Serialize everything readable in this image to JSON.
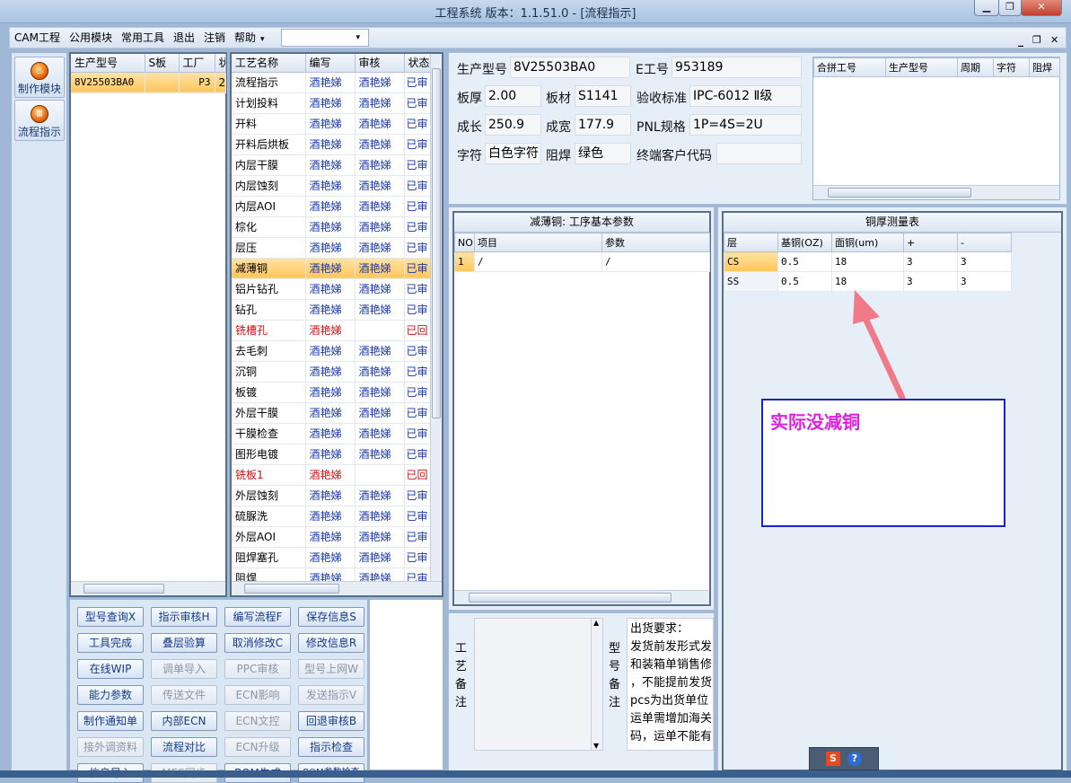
{
  "window": {
    "title": "工程系统  版本：1.1.51.0 - [流程指示]",
    "min": "▁",
    "max": "❐",
    "close": "✕"
  },
  "menu": {
    "items": [
      "CAM工程",
      "公用模块",
      "常用工具",
      "退出",
      "注销",
      "帮助"
    ],
    "dropdown_arrow": "▾",
    "ctl_min": "_",
    "ctl_restore": "❐",
    "ctl_close": "✕"
  },
  "nav": [
    {
      "label": "制作模块",
      "icon": "fire-icon"
    },
    {
      "label": "流程指示",
      "icon": "flow-icon"
    }
  ],
  "model_table": {
    "headers": [
      "生产型号",
      "S板",
      "工厂",
      "状"
    ],
    "rows": [
      [
        "8V25503BA0",
        "",
        "P3",
        "2"
      ]
    ]
  },
  "process_table": {
    "headers": [
      "工艺名称",
      "编写",
      "审核",
      "状态"
    ],
    "rows": [
      {
        "name": "流程指示",
        "writer": "酒艳娣",
        "reviewer": "酒艳娣",
        "status": "已审",
        "red": false,
        "sel": false
      },
      {
        "name": "计划投料",
        "writer": "酒艳娣",
        "reviewer": "酒艳娣",
        "status": "已审",
        "red": false,
        "sel": false
      },
      {
        "name": "开料",
        "writer": "酒艳娣",
        "reviewer": "酒艳娣",
        "status": "已审",
        "red": false,
        "sel": false
      },
      {
        "name": "开料后烘板",
        "writer": "酒艳娣",
        "reviewer": "酒艳娣",
        "status": "已审",
        "red": false,
        "sel": false
      },
      {
        "name": "内层干膜",
        "writer": "酒艳娣",
        "reviewer": "酒艳娣",
        "status": "已审",
        "red": false,
        "sel": false
      },
      {
        "name": "内层蚀刻",
        "writer": "酒艳娣",
        "reviewer": "酒艳娣",
        "status": "已审",
        "red": false,
        "sel": false
      },
      {
        "name": "内层AOI",
        "writer": "酒艳娣",
        "reviewer": "酒艳娣",
        "status": "已审",
        "red": false,
        "sel": false
      },
      {
        "name": "棕化",
        "writer": "酒艳娣",
        "reviewer": "酒艳娣",
        "status": "已审",
        "red": false,
        "sel": false
      },
      {
        "name": "层压",
        "writer": "酒艳娣",
        "reviewer": "酒艳娣",
        "status": "已审",
        "red": false,
        "sel": false
      },
      {
        "name": "减薄铜",
        "writer": "酒艳娣",
        "reviewer": "酒艳娣",
        "status": "已审",
        "red": false,
        "sel": true
      },
      {
        "name": "铝片钻孔",
        "writer": "酒艳娣",
        "reviewer": "酒艳娣",
        "status": "已审",
        "red": false,
        "sel": false
      },
      {
        "name": "钻孔",
        "writer": "酒艳娣",
        "reviewer": "酒艳娣",
        "status": "已审",
        "red": false,
        "sel": false
      },
      {
        "name": "铣槽孔",
        "writer": "酒艳娣",
        "reviewer": "",
        "status": "已回",
        "red": true,
        "sel": false
      },
      {
        "name": "去毛刺",
        "writer": "酒艳娣",
        "reviewer": "酒艳娣",
        "status": "已审",
        "red": false,
        "sel": false
      },
      {
        "name": "沉铜",
        "writer": "酒艳娣",
        "reviewer": "酒艳娣",
        "status": "已审",
        "red": false,
        "sel": false
      },
      {
        "name": "板镀",
        "writer": "酒艳娣",
        "reviewer": "酒艳娣",
        "status": "已审",
        "red": false,
        "sel": false
      },
      {
        "name": "外层干膜",
        "writer": "酒艳娣",
        "reviewer": "酒艳娣",
        "status": "已审",
        "red": false,
        "sel": false
      },
      {
        "name": "干膜检查",
        "writer": "酒艳娣",
        "reviewer": "酒艳娣",
        "status": "已审",
        "red": false,
        "sel": false
      },
      {
        "name": "图形电镀",
        "writer": "酒艳娣",
        "reviewer": "酒艳娣",
        "status": "已审",
        "red": false,
        "sel": false
      },
      {
        "name": "铣板1",
        "writer": "酒艳娣",
        "reviewer": "",
        "status": "已回",
        "red": true,
        "sel": false
      },
      {
        "name": "外层蚀刻",
        "writer": "酒艳娣",
        "reviewer": "酒艳娣",
        "status": "已审",
        "red": false,
        "sel": false
      },
      {
        "name": "硫脲洗",
        "writer": "酒艳娣",
        "reviewer": "酒艳娣",
        "status": "已审",
        "red": false,
        "sel": false
      },
      {
        "name": "外层AOI",
        "writer": "酒艳娣",
        "reviewer": "酒艳娣",
        "status": "已审",
        "red": false,
        "sel": false
      },
      {
        "name": "阻焊塞孔",
        "writer": "酒艳娣",
        "reviewer": "酒艳娣",
        "status": "已审",
        "red": false,
        "sel": false
      },
      {
        "name": "阻焊",
        "writer": "酒艳娣",
        "reviewer": "酒艳娣",
        "status": "已审",
        "red": false,
        "sel": false
      }
    ]
  },
  "buttons": [
    {
      "label": "型号查询X",
      "enabled": true
    },
    {
      "label": "指示审核H",
      "enabled": true
    },
    {
      "label": "编写流程F",
      "enabled": true
    },
    {
      "label": "保存信息S",
      "enabled": true
    },
    {
      "label": "工具完成",
      "enabled": true
    },
    {
      "label": "叠层验算",
      "enabled": true
    },
    {
      "label": "取消修改C",
      "enabled": true
    },
    {
      "label": "修改信息R",
      "enabled": true
    },
    {
      "label": "在线WIP",
      "enabled": true
    },
    {
      "label": "调单导入",
      "enabled": false
    },
    {
      "label": "PPC审核",
      "enabled": false
    },
    {
      "label": "型号上网W",
      "enabled": false
    },
    {
      "label": "能力参数",
      "enabled": true
    },
    {
      "label": "传送文件",
      "enabled": false
    },
    {
      "label": "ECN影响",
      "enabled": false
    },
    {
      "label": "发送指示V",
      "enabled": false
    },
    {
      "label": "制作通知单",
      "enabled": true
    },
    {
      "label": "内部ECN",
      "enabled": true
    },
    {
      "label": "ECN文控",
      "enabled": false
    },
    {
      "label": "回退审核B",
      "enabled": true
    },
    {
      "label": "接外调资料",
      "enabled": false
    },
    {
      "label": "流程对比",
      "enabled": true
    },
    {
      "label": "ECN升级",
      "enabled": false
    },
    {
      "label": "指示检查",
      "enabled": true
    },
    {
      "label": "信息导入",
      "enabled": true
    },
    {
      "label": "MES同步",
      "enabled": false
    },
    {
      "label": "BOM生成",
      "enabled": true
    },
    {
      "label": "BOM参数检查",
      "enabled": true
    }
  ],
  "info": {
    "prod_model_label": "生产型号",
    "prod_model": "8V25503BA0",
    "e_no_label": "E工号",
    "e_no": "953189",
    "thickness_label": "板厚",
    "thickness": "2.00",
    "material_label": "板材",
    "material": "S1141",
    "standard_label": "验收标准",
    "standard": "IPC-6012 Ⅱ级",
    "length_label": "成长",
    "length": "250.9",
    "width_label": "成宽",
    "width": "177.9",
    "pnl_label": "PNL规格",
    "pnl": "1P=4S=2U",
    "char_label": "字符",
    "char": "白色字符",
    "mask_label": "阻焊",
    "mask": "绿色",
    "customer_label": "终端客户代码",
    "customer": ""
  },
  "merge_table": {
    "headers": [
      "合拼工号",
      "生产型号",
      "周期",
      "字符",
      "阻焊"
    ]
  },
  "params": {
    "title": "减薄铜: 工序基本参数",
    "headers": [
      "NO",
      "项目",
      "参数"
    ],
    "rows": [
      [
        "1",
        "/",
        "/"
      ]
    ]
  },
  "copper": {
    "title": "铜厚测量表",
    "headers": [
      "层",
      "基铜(OZ)",
      "面铜(um)",
      "+",
      "-"
    ],
    "rows": [
      [
        "CS",
        "0.5",
        "18",
        "3",
        "3"
      ],
      [
        "SS",
        "0.5",
        "18",
        "3",
        "3"
      ]
    ]
  },
  "annotation": {
    "text": "实际没减铜",
    "color": "#e020e0",
    "arrow_color": "#f07a88"
  },
  "notes": {
    "process_label": "工艺备注",
    "model_label": "型号备注",
    "model_text": [
      "出货要求：",
      "发货前发形式发",
      "和装箱单销售修",
      "，不能提前发货",
      "pcs为出货单位",
      "运单需增加海关",
      "码，运单不能有"
    ]
  },
  "tray": {
    "s": "S",
    "help": "?"
  }
}
